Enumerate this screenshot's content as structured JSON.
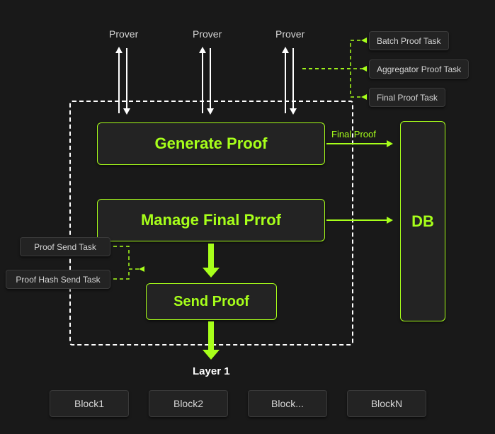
{
  "provers": [
    "Prover",
    "Prover",
    "Prover"
  ],
  "tasks_right": {
    "batch": "Batch Proof Task",
    "aggregator": "Aggregator Proof Task",
    "final": "Final Proof Task"
  },
  "tasks_left": {
    "send": "Proof Send Task",
    "hash_send": "Proof Hash Send Task"
  },
  "modules": {
    "generate": "Generate Proof",
    "manage": "Manage Final Prrof",
    "send": "Send Proof"
  },
  "db": "DB",
  "final_proof_label": "Final Proof",
  "layer1": "Layer 1",
  "blocks": [
    "Block1",
    "Block2",
    "Block...",
    "BlockN"
  ]
}
